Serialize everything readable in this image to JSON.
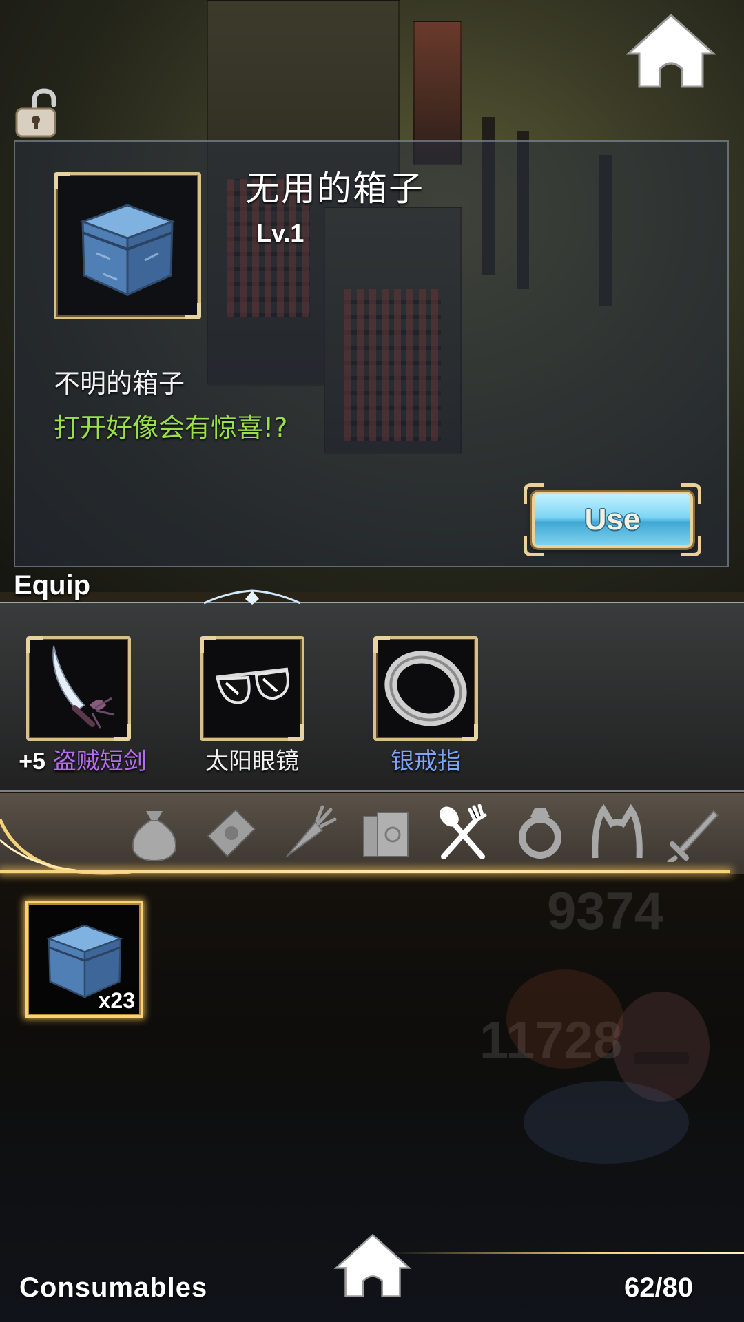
{
  "item_detail": {
    "name": "无用的箱子",
    "level": "Lv.1",
    "description": "不明的箱子",
    "flavor_text": "打开好像会有惊喜!?",
    "use_button_label": "Use",
    "icon": "blue-box-icon"
  },
  "equip": {
    "title": "Equip",
    "slots": [
      {
        "prefix": "+5",
        "name": "盗贼短剑",
        "name_color": "#b46cf0",
        "icon": "dagger-icon"
      },
      {
        "prefix": "",
        "name": "太阳眼镜",
        "name_color": "#f2f2f2",
        "icon": "sunglasses-icon"
      },
      {
        "prefix": "",
        "name": "银戒指",
        "name_color": "#7ea4f5",
        "icon": "ring-icon"
      }
    ]
  },
  "category_tabs": [
    {
      "name": "bag",
      "icon": "money-bag-icon",
      "selected": false
    },
    {
      "name": "scroll",
      "icon": "envelope-icon",
      "selected": false
    },
    {
      "name": "material",
      "icon": "carrot-icon",
      "selected": false
    },
    {
      "name": "book",
      "icon": "book-icon",
      "selected": false
    },
    {
      "name": "consumables",
      "icon": "fork-spoon-icon",
      "selected": true
    },
    {
      "name": "accessory",
      "icon": "ring-icon",
      "selected": false
    },
    {
      "name": "headgear",
      "icon": "cat-ears-icon",
      "selected": false
    },
    {
      "name": "weapon",
      "icon": "sword-icon",
      "selected": false
    }
  ],
  "inventory": {
    "items": [
      {
        "icon": "blue-box-icon",
        "count": "x23",
        "selected": true
      }
    ]
  },
  "background_numbers": [
    "9374",
    "11728"
  ],
  "footer": {
    "category_label": "Consumables",
    "capacity": "62/80"
  },
  "colors": {
    "accent_gold": "#f6d37a",
    "frame_gold": "#d9bf8b",
    "flavor_green": "#9be04a",
    "use_button_blue": "#7fd6f4"
  }
}
